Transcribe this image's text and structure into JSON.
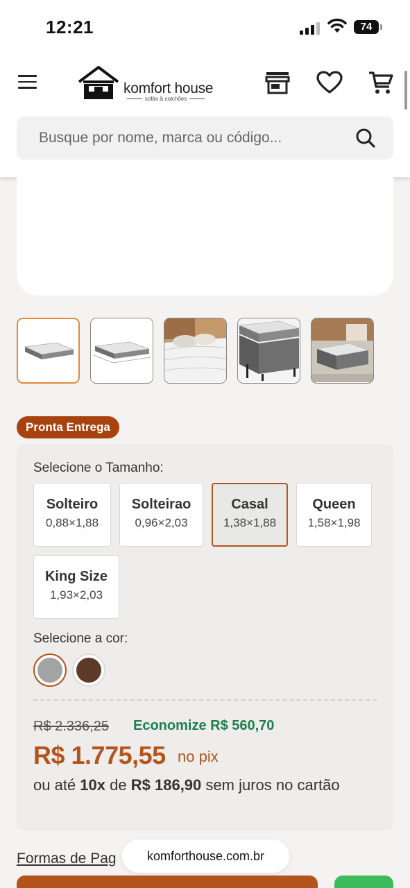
{
  "status_bar": {
    "time": "12:21",
    "battery": "74"
  },
  "header": {
    "logo_name": "komfort house",
    "logo_tagline": "sofás & colchões",
    "search_placeholder": "Busque por nome, marca ou código..."
  },
  "product": {
    "badge": "Pronta Entrega",
    "size_label": "Selecione o Tamanho:",
    "sizes": [
      {
        "name": "Solteiro",
        "dim": "0,88×1,88"
      },
      {
        "name": "Solteirao",
        "dim": "0,96×2,03"
      },
      {
        "name": "Casal",
        "dim": "1,38×1,88"
      },
      {
        "name": "Queen",
        "dim": "1,58×1,98"
      },
      {
        "name": "King Size",
        "dim": "1,93×2,03"
      }
    ],
    "selected_size": "Casal",
    "color_label": "Selecione a cor:",
    "colors": [
      "#a3a3a3",
      "#5e3a2b"
    ],
    "selected_color": "#a3a3a3",
    "old_price": "R$ 2.336,25",
    "economize": "Economize R$ 560,70",
    "price": "R$ 1.775,55",
    "price_suffix": "no pix",
    "installments": {
      "prefix": "ou até",
      "count": "10x",
      "middle": "de",
      "amount": "R$ 186,90",
      "suffix": "sem juros no cartão"
    }
  },
  "footer": {
    "payment_link": "Formas de Pag",
    "url": "komforthouse.com.br"
  },
  "colors": {
    "accent": "#b4541d",
    "badge": "#a8420f",
    "green": "#1d7f4e",
    "highlight": "#e08a3c"
  }
}
